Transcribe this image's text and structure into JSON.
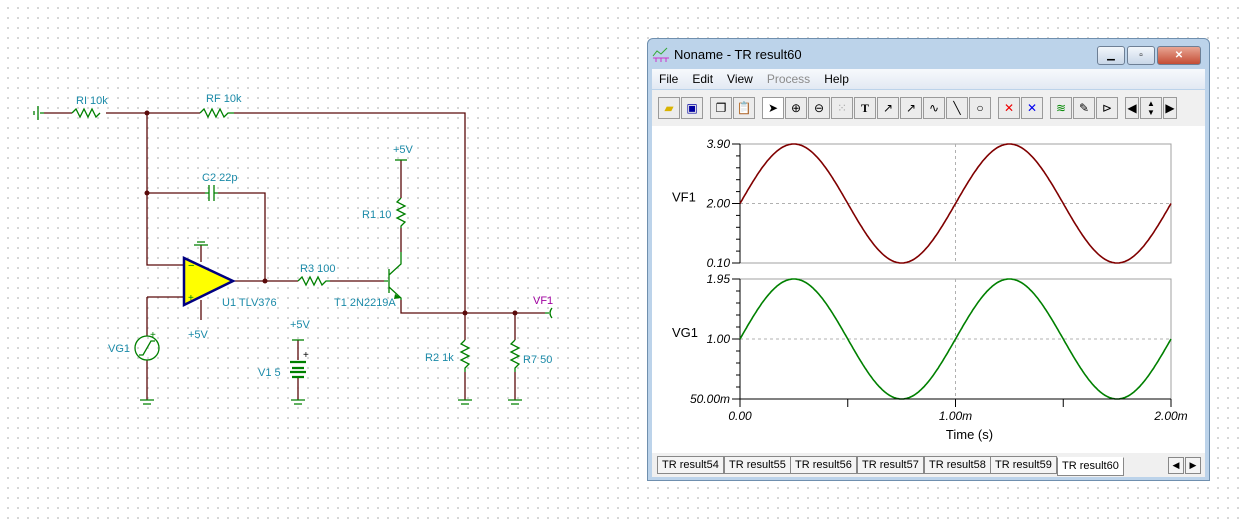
{
  "schematic": {
    "labels": {
      "ri": "RI 10k",
      "rf": "RF 10k",
      "c2": "C2 22p",
      "r1": "R1 10",
      "r3": "R3 100",
      "u1": "U1 TLV376",
      "t1": "T1 2N2219A",
      "r2": "R2 1k",
      "r7": "R7 50",
      "vf1": "VF1",
      "vg1": "VG1",
      "v1": "V1 5",
      "vcc_t1": "+5V",
      "vcc_u1": "+5V",
      "vcc_v1": "+5V"
    },
    "colors": {
      "wire": "#5a0a0a",
      "component": "#008000",
      "opamp_fill": "#ffff00",
      "opamp_border": "#000080",
      "label": "#1b8aa8",
      "probe_label": "#a000a0",
      "pin": "#e00000"
    }
  },
  "window": {
    "title": "Noname - TR result60",
    "controls": [
      "minimize",
      "maximize",
      "close"
    ],
    "menu": [
      {
        "label": "File",
        "enabled": true
      },
      {
        "label": "Edit",
        "enabled": true
      },
      {
        "label": "View",
        "enabled": true
      },
      {
        "label": "Process",
        "enabled": false
      },
      {
        "label": "Help",
        "enabled": true
      }
    ],
    "toolbar": [
      "open-folder",
      "save",
      "copy",
      "paste",
      "pointer",
      "zoom-in",
      "zoom-100",
      "grid",
      "text",
      "curve-label",
      "curve-question",
      "curve-legend",
      "line",
      "circle",
      "cursor-a",
      "cursor-b",
      "add-curves",
      "probe",
      "flag",
      "scroll-left",
      "scroll-up",
      "scroll-down",
      "scroll-right"
    ],
    "tabs": [
      "TR result54",
      "TR result55",
      "TR result56",
      "TR result57",
      "TR result58",
      "TR result59",
      "TR result60"
    ],
    "active_tab": "TR result60"
  },
  "chart_data": [
    {
      "type": "line",
      "series": [
        {
          "name": "VF1",
          "color": "#800000",
          "function": "2.0 + 1.9*sin(2*pi*1000*t)"
        }
      ],
      "ylabel": "VF1",
      "yticks": [
        "0.10",
        "2.00",
        "3.90"
      ],
      "ylim": [
        0.1,
        3.9
      ],
      "xlim": [
        0,
        0.002
      ],
      "grid": true
    },
    {
      "type": "line",
      "series": [
        {
          "name": "VG1",
          "color": "#008000",
          "function": "1.0 + 0.95*sin(2*pi*1000*t)"
        }
      ],
      "ylabel": "VG1",
      "yticks": [
        "50.00m",
        "1.00",
        "1.95"
      ],
      "ylim": [
        0.05,
        1.95
      ],
      "xlim": [
        0,
        0.002
      ],
      "grid": true,
      "xticks": [
        "0.00",
        "1.00m",
        "2.00m"
      ],
      "xlabel": "Time (s)"
    }
  ]
}
